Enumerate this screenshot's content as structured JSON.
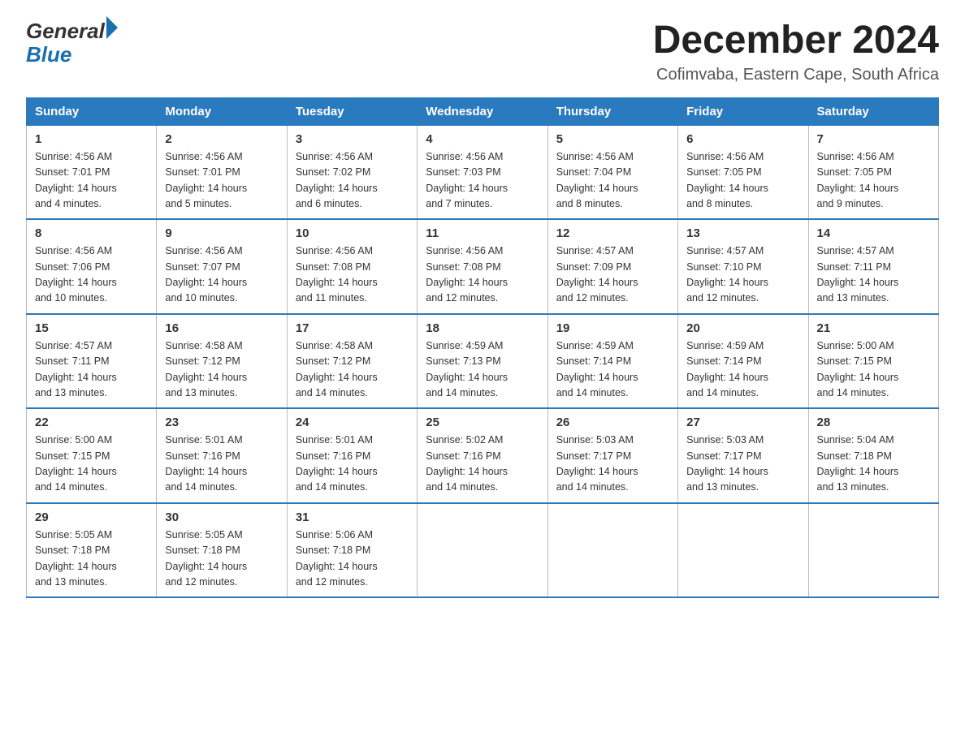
{
  "logo": {
    "general": "General",
    "blue": "Blue"
  },
  "title": "December 2024",
  "location": "Cofimvaba, Eastern Cape, South Africa",
  "days_of_week": [
    "Sunday",
    "Monday",
    "Tuesday",
    "Wednesday",
    "Thursday",
    "Friday",
    "Saturday"
  ],
  "weeks": [
    [
      {
        "num": "1",
        "sunrise": "4:56 AM",
        "sunset": "7:01 PM",
        "daylight": "14 hours and 4 minutes."
      },
      {
        "num": "2",
        "sunrise": "4:56 AM",
        "sunset": "7:01 PM",
        "daylight": "14 hours and 5 minutes."
      },
      {
        "num": "3",
        "sunrise": "4:56 AM",
        "sunset": "7:02 PM",
        "daylight": "14 hours and 6 minutes."
      },
      {
        "num": "4",
        "sunrise": "4:56 AM",
        "sunset": "7:03 PM",
        "daylight": "14 hours and 7 minutes."
      },
      {
        "num": "5",
        "sunrise": "4:56 AM",
        "sunset": "7:04 PM",
        "daylight": "14 hours and 8 minutes."
      },
      {
        "num": "6",
        "sunrise": "4:56 AM",
        "sunset": "7:05 PM",
        "daylight": "14 hours and 8 minutes."
      },
      {
        "num": "7",
        "sunrise": "4:56 AM",
        "sunset": "7:05 PM",
        "daylight": "14 hours and 9 minutes."
      }
    ],
    [
      {
        "num": "8",
        "sunrise": "4:56 AM",
        "sunset": "7:06 PM",
        "daylight": "14 hours and 10 minutes."
      },
      {
        "num": "9",
        "sunrise": "4:56 AM",
        "sunset": "7:07 PM",
        "daylight": "14 hours and 10 minutes."
      },
      {
        "num": "10",
        "sunrise": "4:56 AM",
        "sunset": "7:08 PM",
        "daylight": "14 hours and 11 minutes."
      },
      {
        "num": "11",
        "sunrise": "4:56 AM",
        "sunset": "7:08 PM",
        "daylight": "14 hours and 12 minutes."
      },
      {
        "num": "12",
        "sunrise": "4:57 AM",
        "sunset": "7:09 PM",
        "daylight": "14 hours and 12 minutes."
      },
      {
        "num": "13",
        "sunrise": "4:57 AM",
        "sunset": "7:10 PM",
        "daylight": "14 hours and 12 minutes."
      },
      {
        "num": "14",
        "sunrise": "4:57 AM",
        "sunset": "7:11 PM",
        "daylight": "14 hours and 13 minutes."
      }
    ],
    [
      {
        "num": "15",
        "sunrise": "4:57 AM",
        "sunset": "7:11 PM",
        "daylight": "14 hours and 13 minutes."
      },
      {
        "num": "16",
        "sunrise": "4:58 AM",
        "sunset": "7:12 PM",
        "daylight": "14 hours and 13 minutes."
      },
      {
        "num": "17",
        "sunrise": "4:58 AM",
        "sunset": "7:12 PM",
        "daylight": "14 hours and 14 minutes."
      },
      {
        "num": "18",
        "sunrise": "4:59 AM",
        "sunset": "7:13 PM",
        "daylight": "14 hours and 14 minutes."
      },
      {
        "num": "19",
        "sunrise": "4:59 AM",
        "sunset": "7:14 PM",
        "daylight": "14 hours and 14 minutes."
      },
      {
        "num": "20",
        "sunrise": "4:59 AM",
        "sunset": "7:14 PM",
        "daylight": "14 hours and 14 minutes."
      },
      {
        "num": "21",
        "sunrise": "5:00 AM",
        "sunset": "7:15 PM",
        "daylight": "14 hours and 14 minutes."
      }
    ],
    [
      {
        "num": "22",
        "sunrise": "5:00 AM",
        "sunset": "7:15 PM",
        "daylight": "14 hours and 14 minutes."
      },
      {
        "num": "23",
        "sunrise": "5:01 AM",
        "sunset": "7:16 PM",
        "daylight": "14 hours and 14 minutes."
      },
      {
        "num": "24",
        "sunrise": "5:01 AM",
        "sunset": "7:16 PM",
        "daylight": "14 hours and 14 minutes."
      },
      {
        "num": "25",
        "sunrise": "5:02 AM",
        "sunset": "7:16 PM",
        "daylight": "14 hours and 14 minutes."
      },
      {
        "num": "26",
        "sunrise": "5:03 AM",
        "sunset": "7:17 PM",
        "daylight": "14 hours and 14 minutes."
      },
      {
        "num": "27",
        "sunrise": "5:03 AM",
        "sunset": "7:17 PM",
        "daylight": "14 hours and 13 minutes."
      },
      {
        "num": "28",
        "sunrise": "5:04 AM",
        "sunset": "7:18 PM",
        "daylight": "14 hours and 13 minutes."
      }
    ],
    [
      {
        "num": "29",
        "sunrise": "5:05 AM",
        "sunset": "7:18 PM",
        "daylight": "14 hours and 13 minutes."
      },
      {
        "num": "30",
        "sunrise": "5:05 AM",
        "sunset": "7:18 PM",
        "daylight": "14 hours and 12 minutes."
      },
      {
        "num": "31",
        "sunrise": "5:06 AM",
        "sunset": "7:18 PM",
        "daylight": "14 hours and 12 minutes."
      },
      null,
      null,
      null,
      null
    ]
  ],
  "labels": {
    "sunrise": "Sunrise:",
    "sunset": "Sunset:",
    "daylight": "Daylight:"
  }
}
